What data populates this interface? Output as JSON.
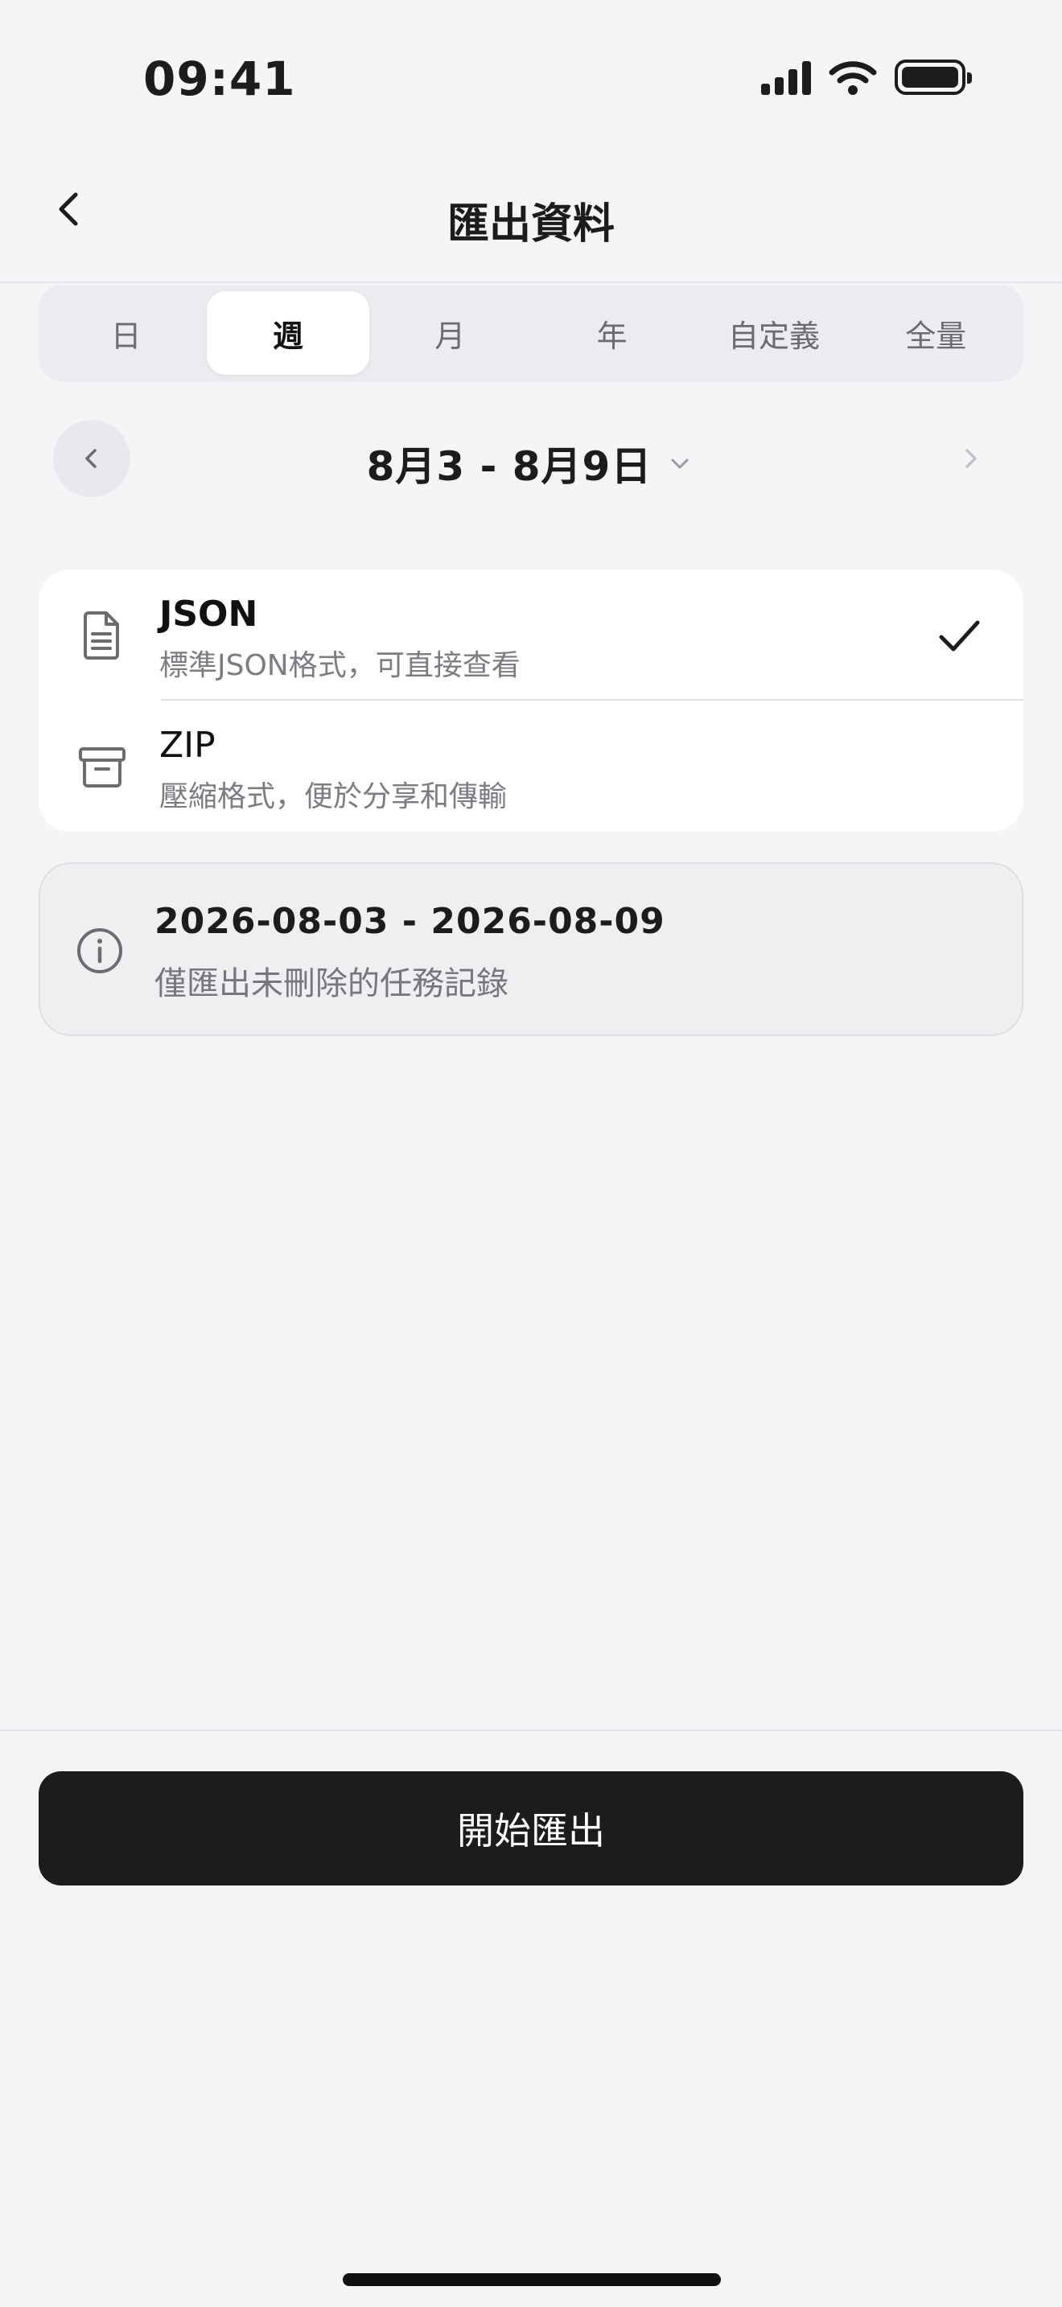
{
  "status_bar": {
    "time": "09:41"
  },
  "nav": {
    "title": "匯出資料"
  },
  "tabs": [
    {
      "label": "日",
      "active": false
    },
    {
      "label": "週",
      "active": true
    },
    {
      "label": "月",
      "active": false
    },
    {
      "label": "年",
      "active": false
    },
    {
      "label": "自定義",
      "active": false
    },
    {
      "label": "全量",
      "active": false
    }
  ],
  "date_nav": {
    "label": "8月3 - 8月9日"
  },
  "formats": [
    {
      "name": "JSON",
      "description": "標準JSON格式，可直接查看",
      "selected": true,
      "icon": "document-icon"
    },
    {
      "name": "ZIP",
      "description": "壓縮格式，便於分享和傳輸",
      "selected": false,
      "icon": "archive-icon"
    }
  ],
  "info": {
    "range": "2026-08-03 - 2026-08-09",
    "note": "僅匯出未刪除的任務記錄"
  },
  "export_button": {
    "label": "開始匯出"
  },
  "colors": {
    "background": "#f4f5f7",
    "button": "#1c1c1e",
    "secondary_text": "#7c7c82"
  }
}
